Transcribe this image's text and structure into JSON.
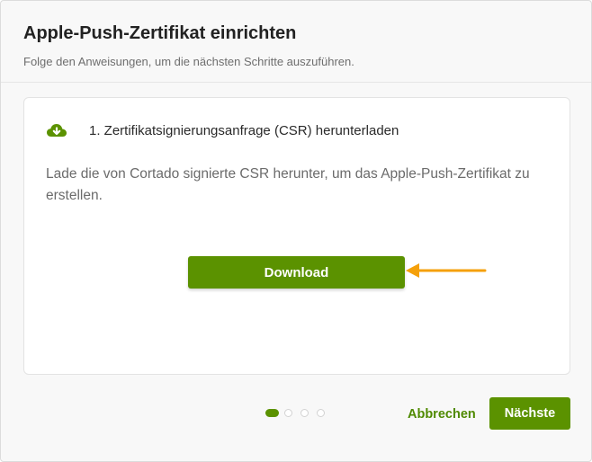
{
  "dialog": {
    "title": "Apple-Push-Zertifikat einrichten",
    "subtitle": "Folge den Anweisungen, um die nächsten Schritte auszuführen."
  },
  "step": {
    "icon": "cloud-download-icon",
    "title": "1. Zertifikatsignierungsanfrage (CSR) herunterladen",
    "description": "Lade die von Cortado signierte CSR herunter, um das Apple-Push-Zertifikat zu erstellen.",
    "download_label": "Download"
  },
  "pagination": {
    "total_steps": 4,
    "current_step": 1
  },
  "footer": {
    "cancel_label": "Abbrechen",
    "next_label": "Nächste"
  },
  "colors": {
    "accent": "#5b9200",
    "annotation_arrow": "#f5a00a"
  }
}
